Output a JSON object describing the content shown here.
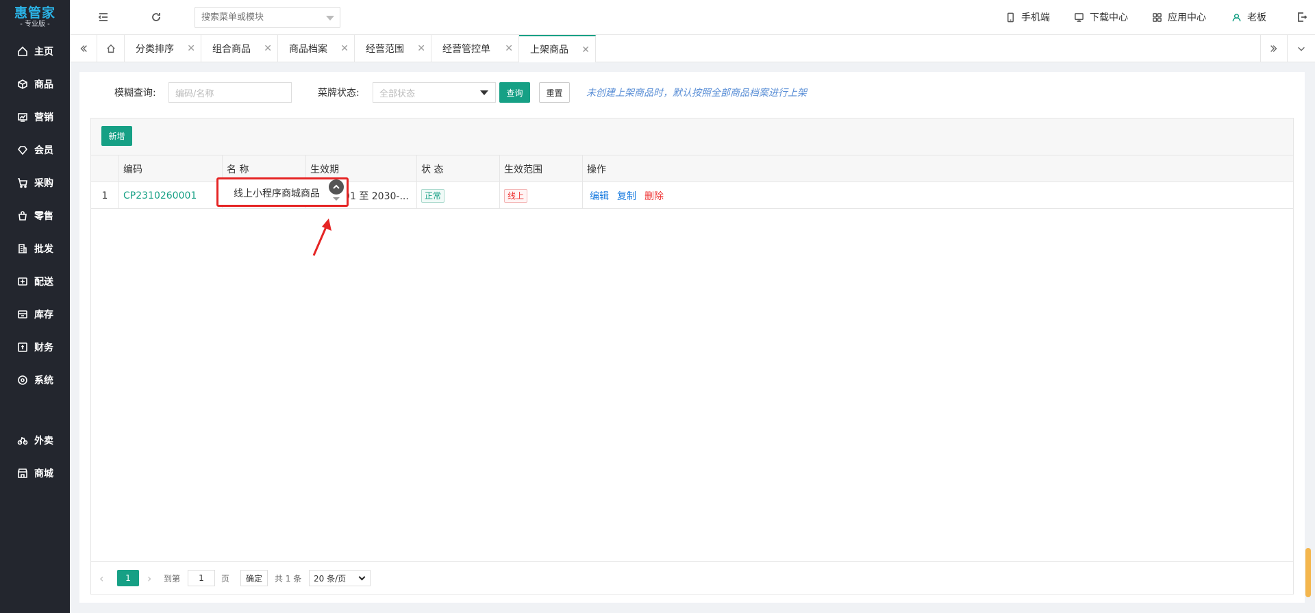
{
  "logo": {
    "main": "惠管家",
    "sub": "- 专业版 -"
  },
  "sidebar": {
    "items": [
      {
        "label": "主页",
        "icon": "home-icon"
      },
      {
        "label": "商品",
        "icon": "box-icon"
      },
      {
        "label": "营销",
        "icon": "chart-icon"
      },
      {
        "label": "会员",
        "icon": "diamond-icon"
      },
      {
        "label": "采购",
        "icon": "cart-icon"
      },
      {
        "label": "零售",
        "icon": "bag-icon"
      },
      {
        "label": "批发",
        "icon": "building-icon"
      },
      {
        "label": "配送",
        "icon": "truck-icon"
      },
      {
        "label": "库存",
        "icon": "warehouse-icon"
      },
      {
        "label": "财务",
        "icon": "finance-icon"
      },
      {
        "label": "系统",
        "icon": "settings-icon"
      },
      {
        "label": "外卖",
        "icon": "bike-icon"
      },
      {
        "label": "商城",
        "icon": "store-icon"
      }
    ]
  },
  "header": {
    "search_placeholder": "搜索菜单或模块",
    "mobile_label": "手机端",
    "download_label": "下载中心",
    "apps_label": "应用中心",
    "user_label": "老板"
  },
  "tabs": [
    {
      "label": "分类排序"
    },
    {
      "label": "组合商品"
    },
    {
      "label": "商品档案"
    },
    {
      "label": "经营范围"
    },
    {
      "label": "经营管控单"
    },
    {
      "label": "上架商品",
      "active": true
    }
  ],
  "filters": {
    "fuzzy_label": "模糊查询:",
    "fuzzy_placeholder": "编码/名称",
    "status_label": "菜牌状态:",
    "status_value": "全部状态",
    "query_button": "查询",
    "reset_button": "重置",
    "hint": "未创建上架商品时，默认按照全部商品档案进行上架"
  },
  "toolbar": {
    "add_button": "新增"
  },
  "table": {
    "columns": [
      "编码",
      "名 称",
      "生效期",
      "状 态",
      "生效范围",
      "操作"
    ],
    "rows": [
      {
        "index": "1",
        "code": "CP2310260001",
        "name": "线上小程序商城商品",
        "period": "-01 至 2030-...",
        "status": "正常",
        "scope": "线上",
        "actions": [
          "编辑",
          "复制",
          "删除"
        ]
      }
    ]
  },
  "pager": {
    "current": "1",
    "goto_label": "到第",
    "goto_value": "1",
    "page_unit": "页",
    "confirm": "确定",
    "total": "共 1 条",
    "page_size": "20 条/页"
  },
  "colors": {
    "accent": "#16a085",
    "sidebar_bg": "#23262e",
    "annotation_red": "#e52424",
    "hint_blue": "#5b8fd6"
  }
}
